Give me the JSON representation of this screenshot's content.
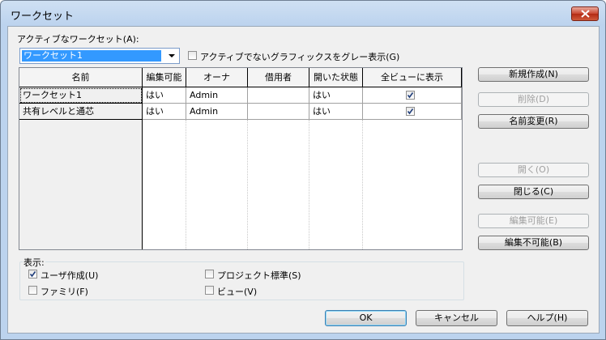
{
  "window": {
    "title": "ワークセット"
  },
  "active_workset": {
    "label": "アクティブなワークセット(A):",
    "selected": "ワークセット1"
  },
  "gray_inactive": {
    "label": "アクティブでないグラフィックスをグレー表示(G)",
    "checked": false
  },
  "table": {
    "columns": [
      "名前",
      "編集可能",
      "オーナ",
      "借用者",
      "開いた状態",
      "全ビューに表示"
    ],
    "rows": [
      {
        "name": "ワークセット1",
        "editable": "はい",
        "owner": "Admin",
        "borrowers": "",
        "opened": "はい",
        "visible_all_views": true
      },
      {
        "name": "共有レベルと通芯",
        "editable": "はい",
        "owner": "Admin",
        "borrowers": "",
        "opened": "はい",
        "visible_all_views": true
      }
    ]
  },
  "side_buttons": {
    "new": "新規作成(N)",
    "delete": "削除(D)",
    "rename": "名前変更(R)",
    "open": "開く(O)",
    "close": "閉じる(C)",
    "editable": "編集可能(E)",
    "non_editable": "編集不可能(B)"
  },
  "show": {
    "label": "表示:",
    "user_created": {
      "label": "ユーザ作成(U)",
      "checked": true
    },
    "families": {
      "label": "ファミリ(F)",
      "checked": false
    },
    "project_standards": {
      "label": "プロジェクト標準(S)",
      "checked": false
    },
    "views": {
      "label": "ビュー(V)",
      "checked": false
    }
  },
  "footer": {
    "ok": "OK",
    "cancel": "キャンセル",
    "help": "ヘルプ(H)"
  },
  "colors": {
    "selection": "#3399ff",
    "close_button": "#c9462f",
    "titlebar": "#bcd3ee"
  }
}
